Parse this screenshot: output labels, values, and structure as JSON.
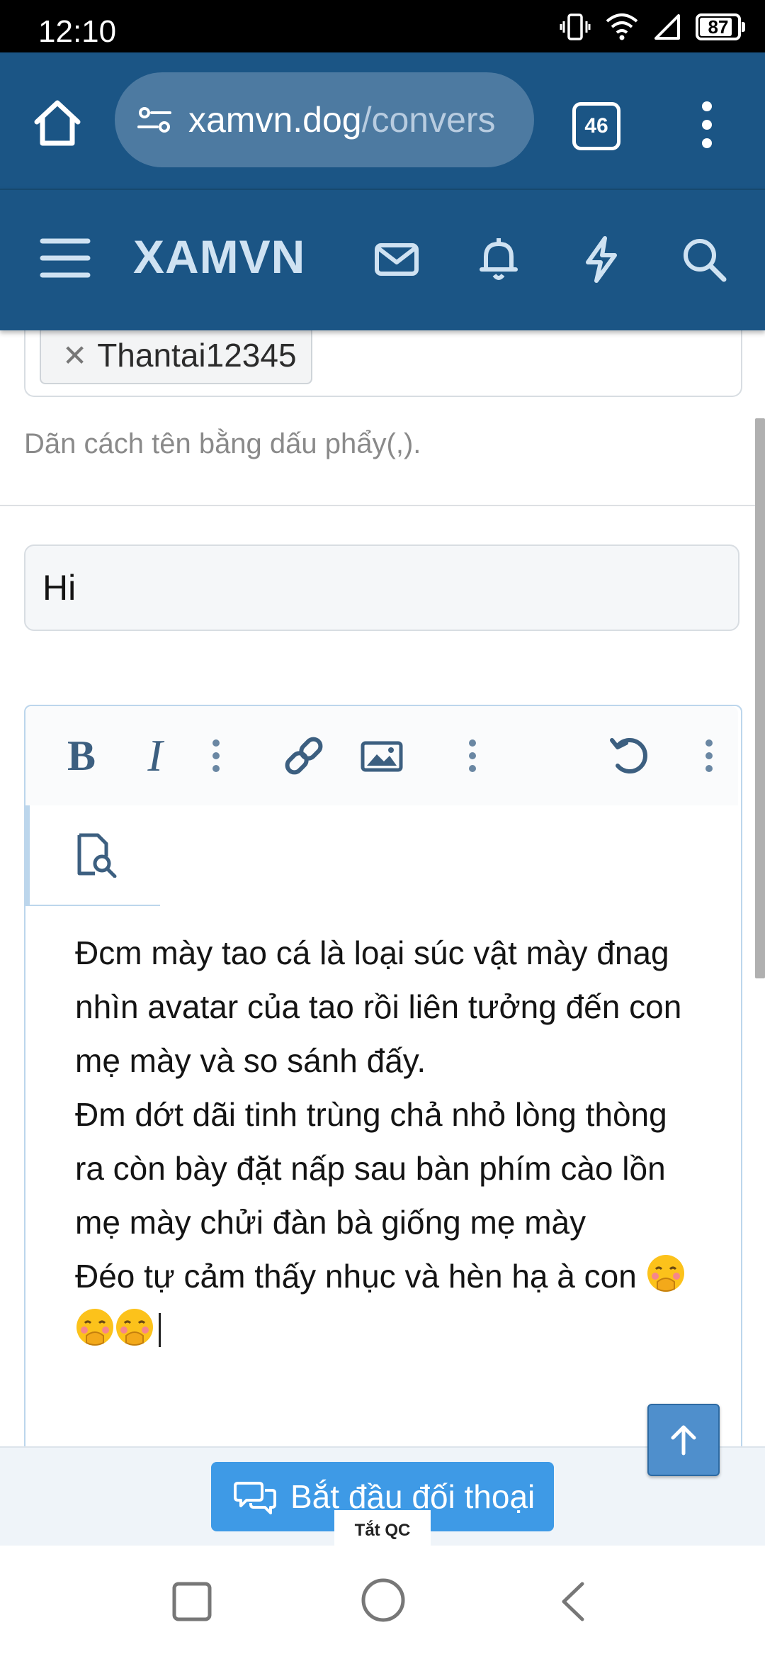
{
  "status_bar": {
    "time": "12:10",
    "battery": "87",
    "battery_level": 0.87
  },
  "browser": {
    "url_domain": "xamvn.dog",
    "url_path": "/convers",
    "tab_count": "46"
  },
  "site": {
    "logo": "XAMVN"
  },
  "form": {
    "recipient_chip": "Thantai12345",
    "recipient_hint": "Dãn cách tên bằng dấu phẩy(,).",
    "title_value": "Hi",
    "message_lines": [
      "Đcm mày tao cá là loại súc vật mày đnag nhìn avatar của tao rồi liên tưởng đến con mẹ mày và so sánh đấy.",
      "Đm dớt dãi tinh trùng chả nhỏ lòng thòng ra còn bày đặt nấp sau bàn phím cào lồn mẹ mày chửi đàn bà giống mẹ mày",
      "Đéo tự cảm thấy nhục và hèn hạ à con"
    ],
    "toolbar": {
      "bold": "B",
      "italic": "I"
    }
  },
  "actions": {
    "start_button": "Bắt đầu đối thoại",
    "ad_close": "Tắt QC"
  },
  "colors": {
    "header": "#1b5585",
    "accent": "#3e9ae6"
  }
}
